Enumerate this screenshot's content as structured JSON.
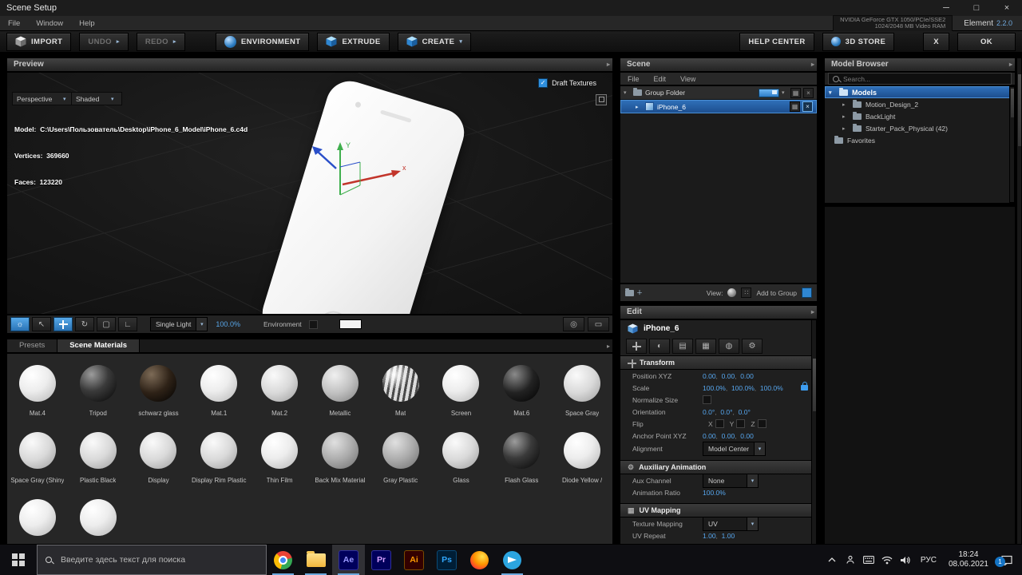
{
  "window": {
    "title": "Scene Setup",
    "menus": [
      "File",
      "Window",
      "Help"
    ],
    "gpu_line1": "NVIDIA GeForce GTX 1050/PCIe/SSE2",
    "gpu_line2": "1024/2048 MB Video RAM",
    "brand": "Element",
    "version": "2.2.0"
  },
  "toolbar": {
    "import": "IMPORT",
    "undo": "UNDO",
    "redo": "REDO",
    "environment": "ENVIRONMENT",
    "extrude": "EXTRUDE",
    "create": "CREATE",
    "help_center": "HELP CENTER",
    "store": "3D STORE",
    "close": "X",
    "ok": "OK"
  },
  "preview": {
    "title": "Preview",
    "draft_textures": "Draft Textures",
    "camera_mode": "Perspective",
    "shading_mode": "Shaded",
    "model_info": "Model:  C:\\Users\\Пользователь\\Desktop\\iPhone_6_Model\\iPhone_6.c4d",
    "vertices": "Vertices:  369660",
    "faces": "Faces:  123220",
    "light_mode": "Single Light",
    "light_intensity": "100.0%",
    "environment_label": "Environment",
    "axis_x": "x",
    "axis_y": "Y"
  },
  "materials_panel": {
    "tabs": [
      "Presets",
      "Scene Materials"
    ],
    "items": [
      {
        "label": "Mat.4",
        "tone": "white"
      },
      {
        "label": "Tripod",
        "tone": "dark"
      },
      {
        "label": "schwarz glass",
        "tone": "brown"
      },
      {
        "label": "Mat.1",
        "tone": "white"
      },
      {
        "label": "Mat.2",
        "tone": "light"
      },
      {
        "label": "Metallic",
        "tone": "silver"
      },
      {
        "label": "Mat",
        "tone": "striped"
      },
      {
        "label": "Screen",
        "tone": "white"
      },
      {
        "label": "Mat.6",
        "tone": "black"
      },
      {
        "label": "Space Gray",
        "tone": "light"
      },
      {
        "label": "Space Gray (Shiny",
        "tone": "light"
      },
      {
        "label": "Plastic Black",
        "tone": "light"
      },
      {
        "label": "Display",
        "tone": "light"
      },
      {
        "label": "Display Rim Plastic",
        "tone": "light"
      },
      {
        "label": "Thin Film",
        "tone": "white"
      },
      {
        "label": "Back Mix Material",
        "tone": "gray"
      },
      {
        "label": "Gray Plastic",
        "tone": "gray"
      },
      {
        "label": "Glass",
        "tone": "light"
      },
      {
        "label": "Flash Glass",
        "tone": "dark"
      },
      {
        "label": "Diode Yellow /",
        "tone": "white"
      },
      {
        "label": "",
        "tone": "white"
      },
      {
        "label": "",
        "tone": "white"
      }
    ]
  },
  "scene_panel": {
    "title": "Scene",
    "menus": [
      "File",
      "Edit",
      "View"
    ],
    "group_label": "Group Folder",
    "object_label": "iPhone_6",
    "view_label": "View:",
    "add_to_group_label": "Add to Group"
  },
  "edit_panel": {
    "title": "Edit",
    "object_name": "iPhone_6",
    "sections": {
      "transform": {
        "title": "Transform",
        "position_label": "Position XYZ",
        "position": [
          "0.00",
          "0.00",
          "0.00"
        ],
        "scale_label": "Scale",
        "scale": [
          "100.0%",
          "100.0%",
          "100.0%"
        ],
        "normalize_label": "Normalize Size",
        "orientation_label": "Orientation",
        "orientation": [
          "0.0°",
          "0.0°",
          "0.0°"
        ],
        "flip_label": "Flip",
        "flip_axes": [
          "X",
          "Y",
          "Z"
        ],
        "anchor_label": "Anchor Point XYZ",
        "anchor": [
          "0.00",
          "0.00",
          "0.00"
        ],
        "alignment_label": "Alignment",
        "alignment_value": "Model Center"
      },
      "aux": {
        "title": "Auxiliary Animation",
        "channel_label": "Aux Channel",
        "channel_value": "None",
        "ratio_label": "Animation Ratio",
        "ratio_value": "100.0%"
      },
      "uv": {
        "title": "UV Mapping",
        "mapping_label": "Texture Mapping",
        "mapping_value": "UV",
        "repeat_label": "UV Repeat",
        "repeat": [
          "1.00",
          "1.00"
        ]
      }
    }
  },
  "model_browser": {
    "title": "Model Browser",
    "search_placeholder": "Search...",
    "root_label": "Models",
    "items": [
      "Motion_Design_2",
      "BackLight",
      "Starter_Pack_Physical (42)"
    ],
    "favorites_label": "Favorites"
  },
  "taskbar": {
    "search_placeholder": "Введите здесь текст для поиска",
    "app_badges": {
      "ae": "Ae",
      "pr": "Pr",
      "ai": "Ai",
      "ps": "Ps"
    },
    "language": "РУС",
    "time": "18:24",
    "date": "08.06.2021",
    "notification_count": "1"
  }
}
